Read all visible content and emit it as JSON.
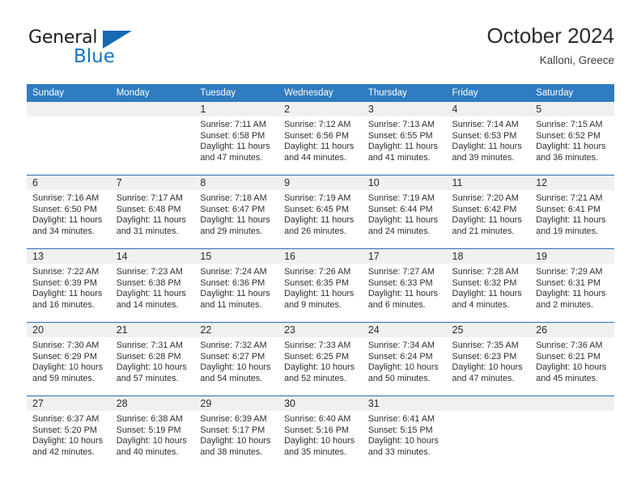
{
  "brand": {
    "name_part1": "General",
    "name_part2": "Blue",
    "triangle_icon": "blue-triangle-icon",
    "colors": {
      "dark": "#1b1b1b",
      "blue": "#1576c4",
      "triangle": "#1668b3"
    }
  },
  "header": {
    "title": "October 2024",
    "subtitle": "Kalloni, Greece"
  },
  "colors": {
    "header_row_bg": "#2f7cc0",
    "header_row_text": "#ffffff",
    "daynum_band_bg": "#f0f0f0",
    "week_divider": "#2a6fb0",
    "cell_text": "#2e2e2e"
  },
  "weekday_headers": [
    "Sunday",
    "Monday",
    "Tuesday",
    "Wednesday",
    "Thursday",
    "Friday",
    "Saturday"
  ],
  "weeks": [
    [
      {
        "day": "",
        "empty": true,
        "sunrise": "",
        "sunset": "",
        "daylight_line1": "",
        "daylight_line2": ""
      },
      {
        "day": "",
        "empty": true,
        "sunrise": "",
        "sunset": "",
        "daylight_line1": "",
        "daylight_line2": ""
      },
      {
        "day": "1",
        "empty": false,
        "sunrise": "Sunrise: 7:11 AM",
        "sunset": "Sunset: 6:58 PM",
        "daylight_line1": "Daylight: 11 hours",
        "daylight_line2": "and 47 minutes."
      },
      {
        "day": "2",
        "empty": false,
        "sunrise": "Sunrise: 7:12 AM",
        "sunset": "Sunset: 6:56 PM",
        "daylight_line1": "Daylight: 11 hours",
        "daylight_line2": "and 44 minutes."
      },
      {
        "day": "3",
        "empty": false,
        "sunrise": "Sunrise: 7:13 AM",
        "sunset": "Sunset: 6:55 PM",
        "daylight_line1": "Daylight: 11 hours",
        "daylight_line2": "and 41 minutes."
      },
      {
        "day": "4",
        "empty": false,
        "sunrise": "Sunrise: 7:14 AM",
        "sunset": "Sunset: 6:53 PM",
        "daylight_line1": "Daylight: 11 hours",
        "daylight_line2": "and 39 minutes."
      },
      {
        "day": "5",
        "empty": false,
        "sunrise": "Sunrise: 7:15 AM",
        "sunset": "Sunset: 6:52 PM",
        "daylight_line1": "Daylight: 11 hours",
        "daylight_line2": "and 36 minutes."
      }
    ],
    [
      {
        "day": "6",
        "empty": false,
        "sunrise": "Sunrise: 7:16 AM",
        "sunset": "Sunset: 6:50 PM",
        "daylight_line1": "Daylight: 11 hours",
        "daylight_line2": "and 34 minutes."
      },
      {
        "day": "7",
        "empty": false,
        "sunrise": "Sunrise: 7:17 AM",
        "sunset": "Sunset: 6:48 PM",
        "daylight_line1": "Daylight: 11 hours",
        "daylight_line2": "and 31 minutes."
      },
      {
        "day": "8",
        "empty": false,
        "sunrise": "Sunrise: 7:18 AM",
        "sunset": "Sunset: 6:47 PM",
        "daylight_line1": "Daylight: 11 hours",
        "daylight_line2": "and 29 minutes."
      },
      {
        "day": "9",
        "empty": false,
        "sunrise": "Sunrise: 7:19 AM",
        "sunset": "Sunset: 6:45 PM",
        "daylight_line1": "Daylight: 11 hours",
        "daylight_line2": "and 26 minutes."
      },
      {
        "day": "10",
        "empty": false,
        "sunrise": "Sunrise: 7:19 AM",
        "sunset": "Sunset: 6:44 PM",
        "daylight_line1": "Daylight: 11 hours",
        "daylight_line2": "and 24 minutes."
      },
      {
        "day": "11",
        "empty": false,
        "sunrise": "Sunrise: 7:20 AM",
        "sunset": "Sunset: 6:42 PM",
        "daylight_line1": "Daylight: 11 hours",
        "daylight_line2": "and 21 minutes."
      },
      {
        "day": "12",
        "empty": false,
        "sunrise": "Sunrise: 7:21 AM",
        "sunset": "Sunset: 6:41 PM",
        "daylight_line1": "Daylight: 11 hours",
        "daylight_line2": "and 19 minutes."
      }
    ],
    [
      {
        "day": "13",
        "empty": false,
        "sunrise": "Sunrise: 7:22 AM",
        "sunset": "Sunset: 6:39 PM",
        "daylight_line1": "Daylight: 11 hours",
        "daylight_line2": "and 16 minutes."
      },
      {
        "day": "14",
        "empty": false,
        "sunrise": "Sunrise: 7:23 AM",
        "sunset": "Sunset: 6:38 PM",
        "daylight_line1": "Daylight: 11 hours",
        "daylight_line2": "and 14 minutes."
      },
      {
        "day": "15",
        "empty": false,
        "sunrise": "Sunrise: 7:24 AM",
        "sunset": "Sunset: 6:36 PM",
        "daylight_line1": "Daylight: 11 hours",
        "daylight_line2": "and 11 minutes."
      },
      {
        "day": "16",
        "empty": false,
        "sunrise": "Sunrise: 7:26 AM",
        "sunset": "Sunset: 6:35 PM",
        "daylight_line1": "Daylight: 11 hours",
        "daylight_line2": "and 9 minutes."
      },
      {
        "day": "17",
        "empty": false,
        "sunrise": "Sunrise: 7:27 AM",
        "sunset": "Sunset: 6:33 PM",
        "daylight_line1": "Daylight: 11 hours",
        "daylight_line2": "and 6 minutes."
      },
      {
        "day": "18",
        "empty": false,
        "sunrise": "Sunrise: 7:28 AM",
        "sunset": "Sunset: 6:32 PM",
        "daylight_line1": "Daylight: 11 hours",
        "daylight_line2": "and 4 minutes."
      },
      {
        "day": "19",
        "empty": false,
        "sunrise": "Sunrise: 7:29 AM",
        "sunset": "Sunset: 6:31 PM",
        "daylight_line1": "Daylight: 11 hours",
        "daylight_line2": "and 2 minutes."
      }
    ],
    [
      {
        "day": "20",
        "empty": false,
        "sunrise": "Sunrise: 7:30 AM",
        "sunset": "Sunset: 6:29 PM",
        "daylight_line1": "Daylight: 10 hours",
        "daylight_line2": "and 59 minutes."
      },
      {
        "day": "21",
        "empty": false,
        "sunrise": "Sunrise: 7:31 AM",
        "sunset": "Sunset: 6:28 PM",
        "daylight_line1": "Daylight: 10 hours",
        "daylight_line2": "and 57 minutes."
      },
      {
        "day": "22",
        "empty": false,
        "sunrise": "Sunrise: 7:32 AM",
        "sunset": "Sunset: 6:27 PM",
        "daylight_line1": "Daylight: 10 hours",
        "daylight_line2": "and 54 minutes."
      },
      {
        "day": "23",
        "empty": false,
        "sunrise": "Sunrise: 7:33 AM",
        "sunset": "Sunset: 6:25 PM",
        "daylight_line1": "Daylight: 10 hours",
        "daylight_line2": "and 52 minutes."
      },
      {
        "day": "24",
        "empty": false,
        "sunrise": "Sunrise: 7:34 AM",
        "sunset": "Sunset: 6:24 PM",
        "daylight_line1": "Daylight: 10 hours",
        "daylight_line2": "and 50 minutes."
      },
      {
        "day": "25",
        "empty": false,
        "sunrise": "Sunrise: 7:35 AM",
        "sunset": "Sunset: 6:23 PM",
        "daylight_line1": "Daylight: 10 hours",
        "daylight_line2": "and 47 minutes."
      },
      {
        "day": "26",
        "empty": false,
        "sunrise": "Sunrise: 7:36 AM",
        "sunset": "Sunset: 6:21 PM",
        "daylight_line1": "Daylight: 10 hours",
        "daylight_line2": "and 45 minutes."
      }
    ],
    [
      {
        "day": "27",
        "empty": false,
        "sunrise": "Sunrise: 6:37 AM",
        "sunset": "Sunset: 5:20 PM",
        "daylight_line1": "Daylight: 10 hours",
        "daylight_line2": "and 42 minutes."
      },
      {
        "day": "28",
        "empty": false,
        "sunrise": "Sunrise: 6:38 AM",
        "sunset": "Sunset: 5:19 PM",
        "daylight_line1": "Daylight: 10 hours",
        "daylight_line2": "and 40 minutes."
      },
      {
        "day": "29",
        "empty": false,
        "sunrise": "Sunrise: 6:39 AM",
        "sunset": "Sunset: 5:17 PM",
        "daylight_line1": "Daylight: 10 hours",
        "daylight_line2": "and 38 minutes."
      },
      {
        "day": "30",
        "empty": false,
        "sunrise": "Sunrise: 6:40 AM",
        "sunset": "Sunset: 5:16 PM",
        "daylight_line1": "Daylight: 10 hours",
        "daylight_line2": "and 35 minutes."
      },
      {
        "day": "31",
        "empty": false,
        "sunrise": "Sunrise: 6:41 AM",
        "sunset": "Sunset: 5:15 PM",
        "daylight_line1": "Daylight: 10 hours",
        "daylight_line2": "and 33 minutes."
      },
      {
        "day": "",
        "empty": true,
        "sunrise": "",
        "sunset": "",
        "daylight_line1": "",
        "daylight_line2": ""
      },
      {
        "day": "",
        "empty": true,
        "sunrise": "",
        "sunset": "",
        "daylight_line1": "",
        "daylight_line2": ""
      }
    ]
  ]
}
